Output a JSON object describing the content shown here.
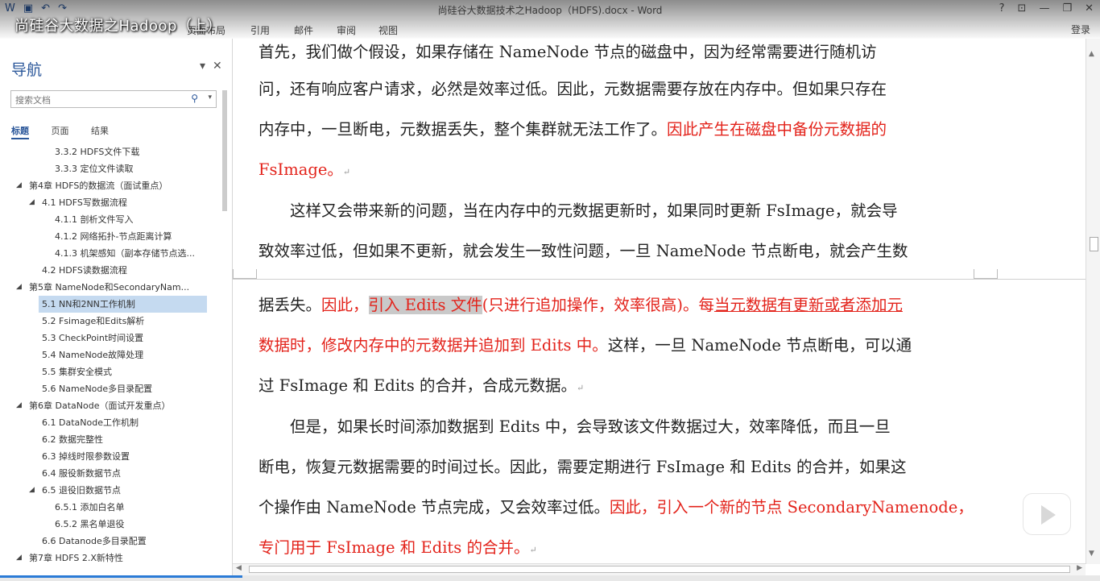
{
  "window": {
    "doc_title": "尚硅谷大数据技术之Hadoop（HDFS).docx - Word",
    "overlay_title": "尚硅谷大数据之Hadoop（上）",
    "login_label": "登录",
    "controls": [
      "?",
      "⊡",
      "—",
      "❐",
      "✕"
    ]
  },
  "ribbon": {
    "tabs": [
      "页面布局",
      "引用",
      "邮件",
      "审阅",
      "视图"
    ]
  },
  "navigation": {
    "title": "导航",
    "search_placeholder": "搜索文档",
    "tabs": [
      "标题",
      "页面",
      "结果"
    ],
    "active_tab": "标题",
    "items": [
      {
        "label": "3.3.2 HDFS文件下载",
        "level": 3,
        "expanded": null
      },
      {
        "label": "3.3.3 定位文件读取",
        "level": 3,
        "expanded": null
      },
      {
        "label": "第4章 HDFS的数据流（面试重点）",
        "level": 1,
        "expanded": true
      },
      {
        "label": "4.1 HDFS写数据流程",
        "level": 2,
        "expanded": true
      },
      {
        "label": "4.1.1 剖析文件写入",
        "level": 3,
        "expanded": null
      },
      {
        "label": "4.1.2 网络拓扑-节点距离计算",
        "level": 3,
        "expanded": null
      },
      {
        "label": "4.1.3 机架感知（副本存储节点选...",
        "level": 3,
        "expanded": null
      },
      {
        "label": "4.2 HDFS读数据流程",
        "level": 2,
        "expanded": null
      },
      {
        "label": "第5章 NameNode和SecondaryNam...",
        "level": 1,
        "expanded": true
      },
      {
        "label": "5.1 NN和2NN工作机制",
        "level": 2,
        "expanded": null,
        "selected": true
      },
      {
        "label": "5.2 Fsimage和Edits解析",
        "level": 2,
        "expanded": null
      },
      {
        "label": "5.3 CheckPoint时间设置",
        "level": 2,
        "expanded": null
      },
      {
        "label": "5.4 NameNode故障处理",
        "level": 2,
        "expanded": null
      },
      {
        "label": "5.5 集群安全模式",
        "level": 2,
        "expanded": null
      },
      {
        "label": "5.6 NameNode多目录配置",
        "level": 2,
        "expanded": null
      },
      {
        "label": "第6章 DataNode（面试开发重点）",
        "level": 1,
        "expanded": true
      },
      {
        "label": "6.1 DataNode工作机制",
        "level": 2,
        "expanded": null
      },
      {
        "label": "6.2 数据完整性",
        "level": 2,
        "expanded": null
      },
      {
        "label": "6.3 掉线时限参数设置",
        "level": 2,
        "expanded": null
      },
      {
        "label": "6.4 服役新数据节点",
        "level": 2,
        "expanded": null
      },
      {
        "label": "6.5 退役旧数据节点",
        "level": 2,
        "expanded": true
      },
      {
        "label": "6.5.1 添加白名单",
        "level": 3,
        "expanded": null
      },
      {
        "label": "6.5.2 黑名单退役",
        "level": 3,
        "expanded": null
      },
      {
        "label": "6.6 Datanode多目录配置",
        "level": 2,
        "expanded": null
      },
      {
        "label": "第7章 HDFS 2.X新特性",
        "level": 1,
        "expanded": true
      }
    ]
  },
  "document": {
    "lines": [
      [
        {
          "t": "首先，我们做个假设，如果存储在 NameNode 节点的磁盘中，因为经常需要进行随机访",
          "s": "n"
        }
      ],
      [
        {
          "t": "问，还有响应客户请求，必然是效率过低。因此，元数据需要存放在内存中。但如果只存在",
          "s": "n"
        }
      ],
      [
        {
          "t": "内存中，一旦断电，元数据丢失，整个集群就无法工作了。",
          "s": "n"
        },
        {
          "t": "因此产生在磁盘中备份元数据的",
          "s": "r"
        }
      ],
      [
        {
          "t": "FsImage。",
          "s": "r"
        },
        {
          "t": "↵",
          "s": "m"
        }
      ],
      [
        {
          "t": "　　这样又会带来新的问题，当在内存中的元数据更新时，如果同时更新 FsImage，就会导",
          "s": "n"
        }
      ],
      [
        {
          "t": "致效率过低，但如果不更新，就会发生一致性问题，一旦 NameNode 节点断电，就会产生数",
          "s": "n"
        }
      ],
      [
        {
          "t": "据丢失。",
          "s": "n"
        },
        {
          "t": "因此，",
          "s": "r"
        },
        {
          "t": "引入 Edits 文件",
          "s": "rh"
        },
        {
          "t": "(只进行追加操作，效率很高)。每",
          "s": "r"
        },
        {
          "t": "当元数据有更新或者添加元",
          "s": "ru"
        }
      ],
      [
        {
          "t": "数据时，修改内存中的元数据并追加到 Edits 中。",
          "s": "r"
        },
        {
          "t": "这样，一旦 NameNode 节点断电，可以通",
          "s": "n"
        }
      ],
      [
        {
          "t": "过 FsImage 和 Edits 的合并，合成元数据。",
          "s": "n"
        },
        {
          "t": "↵",
          "s": "m"
        }
      ],
      [
        {
          "t": "　　但是，如果长时间添加数据到 Edits 中，会导致该文件数据过大，效率降低，而且一旦",
          "s": "n"
        }
      ],
      [
        {
          "t": "断电，恢复元数据需要的时间过长。因此，需要定期进行 FsImage 和 Edits 的合并，如果这",
          "s": "n"
        }
      ],
      [
        {
          "t": "个操作由 NameNode 节点完成，又会效率过低。",
          "s": "n"
        },
        {
          "t": "因此，引入一个新的节点 SecondaryNamenode，",
          "s": "r"
        }
      ],
      [
        {
          "t": "专门用于 FsImage 和 Edits 的合并。",
          "s": "r"
        },
        {
          "t": "↵",
          "s": "m"
        }
      ]
    ]
  },
  "video": {
    "progress": 0.22
  }
}
